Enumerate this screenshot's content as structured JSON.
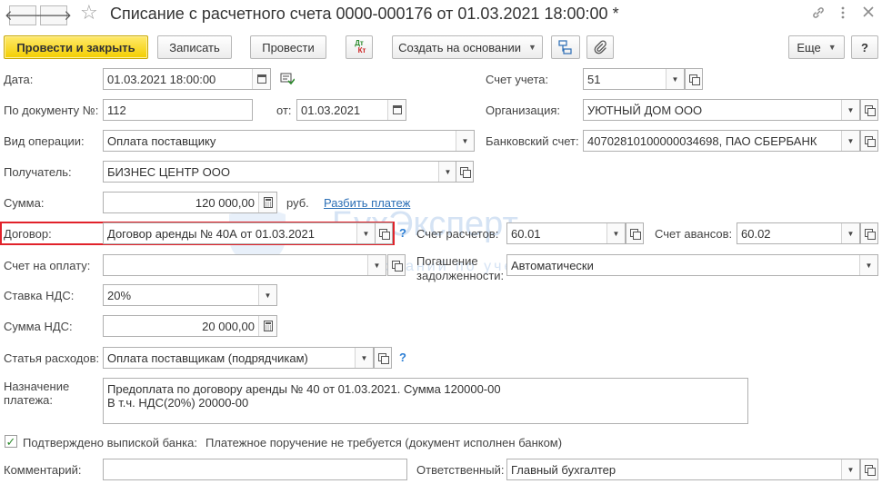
{
  "window": {
    "title": "Списание с расчетного счета 0000-000176 от 01.03.2021 18:00:00 *"
  },
  "icons": {
    "back": "arrow-left-icon",
    "forward": "arrow-right-icon",
    "favorite": "star-icon",
    "link": "link-icon",
    "menu": "more-icon",
    "close": "close-icon",
    "dtkt": "dt-kt-icon",
    "structure": "structure-icon",
    "attach": "paperclip-icon"
  },
  "toolbar": {
    "post_close": "Провести и закрыть",
    "save": "Записать",
    "post": "Провести",
    "dtkt_top": "Дт",
    "dtkt_bottom": "Кт",
    "create_based": "Создать на основании",
    "more": "Еще",
    "help": "?"
  },
  "form": {
    "date": {
      "label": "Дата:",
      "value": "01.03.2021 18:00:00"
    },
    "doc_number": {
      "label": "По документу №:",
      "value": "112",
      "from_label": "от:",
      "from_value": "01.03.2021"
    },
    "operation": {
      "label": "Вид операции:",
      "value": "Оплата поставщику"
    },
    "recipient": {
      "label": "Получатель:",
      "value": "БИЗНЕС ЦЕНТР ООО"
    },
    "amount": {
      "label": "Сумма:",
      "value": "120 000,00",
      "currency": "руб.",
      "split_link": "Разбить платеж"
    },
    "contract": {
      "label": "Договор:",
      "value": "Договор аренды № 40А от 01.03.2021",
      "help": "?"
    },
    "invoice": {
      "label": "Счет на оплату:"
    },
    "vat_rate": {
      "label": "Ставка НДС:",
      "value": "20%"
    },
    "vat_amount": {
      "label": "Сумма НДС:",
      "value": "20 000,00"
    },
    "expense_item": {
      "label": "Статья расходов:",
      "value": "Оплата поставщикам (подрядчикам)",
      "help": "?"
    },
    "purpose": {
      "label_line1": "Назначение",
      "label_line2": "платежа:",
      "line1": "Предоплата по договору аренды № 40 от 01.03.2021. Сумма 120000-00",
      "line2": "В т.ч. НДС(20%) 20000-00"
    },
    "bank_confirmed": {
      "label": "Подтверждено выпиской банка:",
      "checked": true,
      "note": "Платежное поручение не требуется (документ исполнен банком)"
    },
    "comment": {
      "label": "Комментарий:",
      "value": ""
    },
    "account": {
      "label": "Счет учета:",
      "value": "51"
    },
    "organization": {
      "label": "Организация:",
      "value": "УЮТНЫЙ ДОМ ООО"
    },
    "bank_account": {
      "label": "Банковский счет:",
      "value": "40702810100000034698, ПАО СБЕРБАНК"
    },
    "settlement_account": {
      "label": "Счет расчетов:",
      "value": "60.01"
    },
    "advance_account": {
      "label": "Счет авансов:",
      "value": "60.02"
    },
    "debt_repayment": {
      "label_line1": "Погашение",
      "label_line2": "задолженности:",
      "value": "Автоматически"
    },
    "responsible": {
      "label": "Ответственный:",
      "value": "Главный бухгалтер"
    }
  },
  "watermark": {
    "brand": "БухЭксперт",
    "tagline": "База знаний по учету в 1С"
  }
}
